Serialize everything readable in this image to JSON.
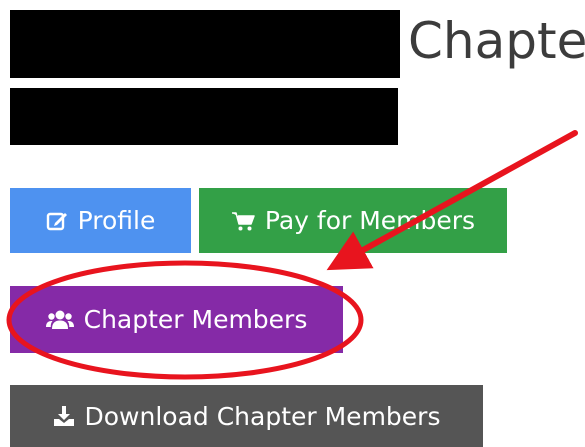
{
  "header": {
    "title_suffix": "Chapter"
  },
  "actions": {
    "profile_label": "Profile",
    "pay_label": "Pay for Members",
    "chapter_members_label": "Chapter Members",
    "download_label": "Download Chapter Members"
  },
  "icons": {
    "profile": "edit-icon",
    "pay": "cart-icon",
    "chapter_members": "users-icon",
    "download": "download-icon"
  },
  "colors": {
    "profile_button": "#4e92f0",
    "pay_button": "#33a047",
    "chapter_members_button": "#852aa7",
    "download_button": "#555555",
    "annotation": "#e8141e"
  }
}
